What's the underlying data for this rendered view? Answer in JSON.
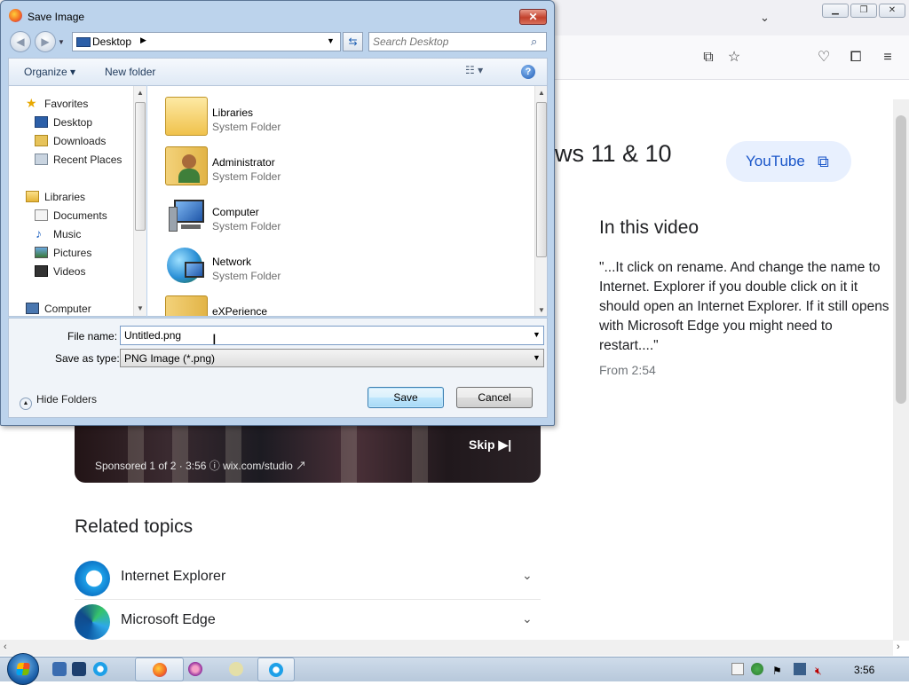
{
  "dialog": {
    "title": "Save Image",
    "address": "Desktop",
    "search_placeholder": "Search Desktop",
    "organize_label": "Organize",
    "new_folder_label": "New folder",
    "nav_items": [
      {
        "label": "Favorites",
        "icon": "star-icon"
      },
      {
        "label": "Desktop",
        "icon": "desktop-icon"
      },
      {
        "label": "Downloads",
        "icon": "downloads-icon"
      },
      {
        "label": "Recent Places",
        "icon": "recent-places-icon"
      },
      {
        "label": "Libraries",
        "icon": "libraries-icon"
      },
      {
        "label": "Documents",
        "icon": "documents-icon"
      },
      {
        "label": "Music",
        "icon": "music-icon"
      },
      {
        "label": "Pictures",
        "icon": "pictures-icon"
      },
      {
        "label": "Videos",
        "icon": "videos-icon"
      },
      {
        "label": "Computer",
        "icon": "computer-icon"
      }
    ],
    "files": [
      {
        "name": "Libraries",
        "type": "System Folder"
      },
      {
        "name": "Administrator",
        "type": "System Folder"
      },
      {
        "name": "Computer",
        "type": "System Folder"
      },
      {
        "name": "Network",
        "type": "System Folder"
      },
      {
        "name": "eXPerience",
        "type": ""
      }
    ],
    "file_name_label": "File name:",
    "file_name_value": "Untitled.png",
    "save_type_label": "Save as type:",
    "save_type_value": "PNG Image (*.png)",
    "hide_folders_label": "Hide Folders",
    "save_label": "Save",
    "cancel_label": "Cancel"
  },
  "page": {
    "heading_fragment": "ws 11 & 10",
    "youtube_label": "YouTube",
    "video_section_title": "In this video",
    "video_quote": "\"...It click on rename. And change the name to Internet. Explorer if you double click on it it should open an Internet Explorer. If it still opens with Microsoft Edge you might need to restart....\"",
    "video_from": "From 2:54",
    "ad_sponsor": "Sponsored 1 of 2 · 3:56 ⓘ wix.com/studio ↗",
    "ad_skip": "Skip ▶|",
    "related_title": "Related topics",
    "related_items": [
      "Internet Explorer",
      "Microsoft Edge"
    ]
  },
  "taskbar": {
    "clock": "3:56"
  },
  "colors": {
    "dialog_frame": "#bcd3ec",
    "accent_blue": "#1a56c9",
    "youtube_chip_bg": "#e8f0fe"
  }
}
